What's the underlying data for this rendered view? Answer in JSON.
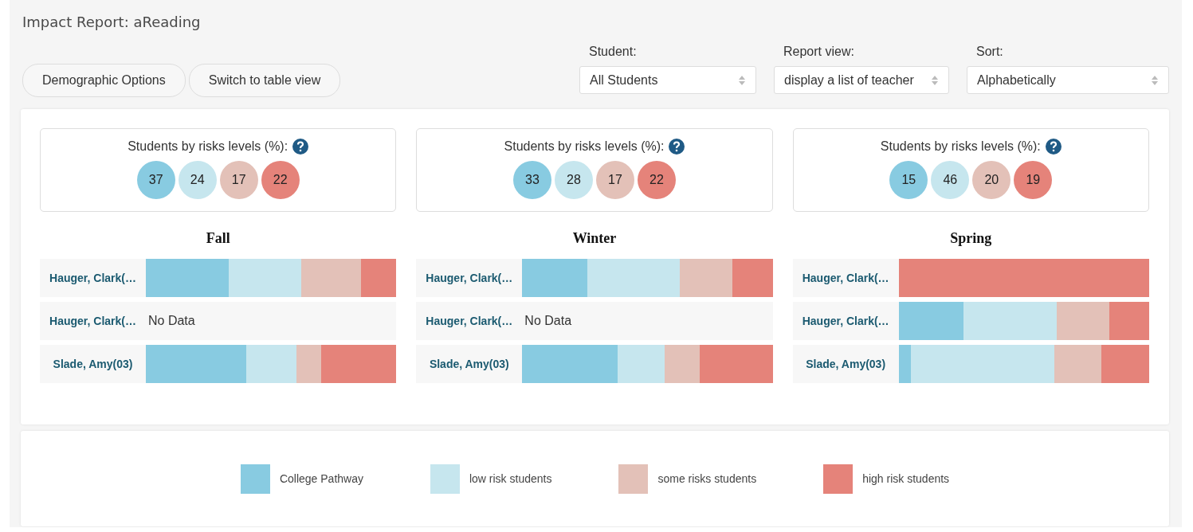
{
  "title": "Impact Report: aReading",
  "buttons": [
    "Demographic Options",
    "Switch to table view"
  ],
  "selects": [
    {
      "label": "Student:",
      "value": "All Students"
    },
    {
      "label": "Report view:",
      "value": "display a list of teacher"
    },
    {
      "label": "Sort:",
      "value": "Alphabetically"
    }
  ],
  "seasons": [
    {
      "summary_label": "Students by risks levels (%):",
      "circles": [
        {
          "value": "37",
          "color": "#88cbe1"
        },
        {
          "value": "24",
          "color": "#c6e6ee"
        },
        {
          "value": "17",
          "color": "#e3c1b8"
        },
        {
          "value": "22",
          "color": "#e5837a"
        }
      ],
      "name": "Fall",
      "rows": [
        {
          "teacher": "Hauger, Clark(…",
          "segments": [
            {
              "color": "#88cbe1"
            },
            {
              "color": "#c6e6ee"
            },
            {
              "color": "#e3c1b8"
            },
            {
              "color": "#e5837a"
            }
          ]
        },
        {
          "teacher": "Hauger, Clark(…",
          "no_data": "No Data"
        },
        {
          "teacher": "Slade, Amy(03)",
          "segments": [
            {
              "color": "#88cbe1"
            },
            {
              "color": "#c6e6ee"
            },
            {
              "color": "#e3c1b8"
            },
            {
              "color": "#e5837a"
            }
          ]
        }
      ]
    },
    {
      "summary_label": "Students by risks levels (%):",
      "circles": [
        {
          "value": "33",
          "color": "#88cbe1"
        },
        {
          "value": "28",
          "color": "#c6e6ee"
        },
        {
          "value": "17",
          "color": "#e3c1b8"
        },
        {
          "value": "22",
          "color": "#e5837a"
        }
      ],
      "name": "Winter",
      "rows": [
        {
          "teacher": "Hauger, Clark(…",
          "segments": [
            {
              "color": "#88cbe1"
            },
            {
              "color": "#c6e6ee"
            },
            {
              "color": "#e3c1b8"
            },
            {
              "color": "#e5837a"
            }
          ]
        },
        {
          "teacher": "Hauger, Clark(…",
          "no_data": "No Data"
        },
        {
          "teacher": "Slade, Amy(03)",
          "segments": [
            {
              "color": "#88cbe1"
            },
            {
              "color": "#c6e6ee"
            },
            {
              "color": "#e3c1b8"
            },
            {
              "color": "#e5837a"
            }
          ]
        }
      ]
    },
    {
      "summary_label": "Students by risks levels (%):",
      "circles": [
        {
          "value": "15",
          "color": "#88cbe1"
        },
        {
          "value": "46",
          "color": "#c6e6ee"
        },
        {
          "value": "20",
          "color": "#e3c1b8"
        },
        {
          "value": "19",
          "color": "#e5837a"
        }
      ],
      "name": "Spring",
      "rows": [
        {
          "teacher": "Hauger, Clark(…",
          "segments": [
            {
              "color": "#e5837a"
            }
          ]
        },
        {
          "teacher": "Hauger, Clark(…",
          "segments": [
            {
              "color": "#88cbe1"
            },
            {
              "color": "#c6e6ee"
            },
            {
              "color": "#e3c1b8"
            },
            {
              "color": "#e5837a"
            }
          ]
        },
        {
          "teacher": "Slade, Amy(03)",
          "segments": [
            {
              "color": "#88cbe1"
            },
            {
              "color": "#c6e6ee"
            },
            {
              "color": "#e3c1b8"
            },
            {
              "color": "#e5837a"
            }
          ]
        }
      ]
    }
  ],
  "legend": [
    {
      "label": "College Pathway",
      "color": "#88cbe1"
    },
    {
      "label": "low risk students",
      "color": "#c6e6ee"
    },
    {
      "label": "some risks students",
      "color": "#e3c1b8"
    },
    {
      "label": "high risk students",
      "color": "#e5837a"
    }
  ]
}
